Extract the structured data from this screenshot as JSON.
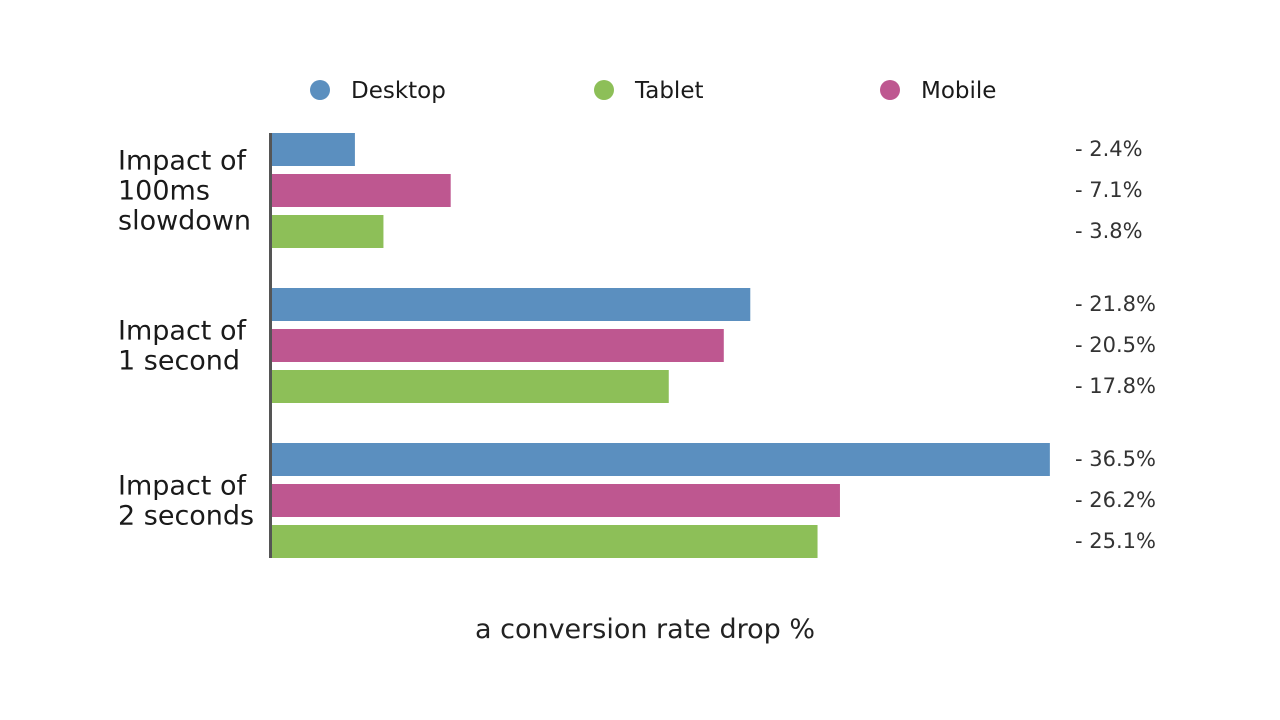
{
  "chart_data": {
    "type": "bar",
    "orientation": "horizontal",
    "title": "",
    "xlabel": "a conversion rate drop %",
    "ylabel": "",
    "legend_position": "top",
    "grid": false,
    "series_order_in_groups": [
      "Desktop",
      "Mobile",
      "Tablet"
    ],
    "legend": [
      {
        "name": "Desktop",
        "color": "#5b8fbf"
      },
      {
        "name": "Tablet",
        "color": "#8dbf58"
      },
      {
        "name": "Mobile",
        "color": "#be5790"
      }
    ],
    "categories": [
      {
        "label_lines": [
          "Impact of",
          "100ms",
          "slowdown"
        ]
      },
      {
        "label_lines": [
          "Impact of",
          "1 second"
        ]
      },
      {
        "label_lines": [
          "Impact of",
          "2 seconds"
        ]
      }
    ],
    "series": [
      {
        "name": "Desktop",
        "color": "#5b8fbf",
        "values": [
          2.4,
          21.8,
          36.5
        ],
        "labels": [
          "- 2.4%",
          "- 21.8%",
          "- 36.5%"
        ]
      },
      {
        "name": "Mobile",
        "color": "#be5790",
        "values": [
          7.1,
          20.5,
          26.2
        ],
        "labels": [
          "- 7.1%",
          "- 20.5%",
          "- 26.2%"
        ]
      },
      {
        "name": "Tablet",
        "color": "#8dbf58",
        "values": [
          3.8,
          17.8,
          25.1
        ],
        "labels": [
          "- 3.8%",
          "- 17.8%",
          "- 25.1%"
        ]
      }
    ],
    "axis_color": "#555555"
  }
}
